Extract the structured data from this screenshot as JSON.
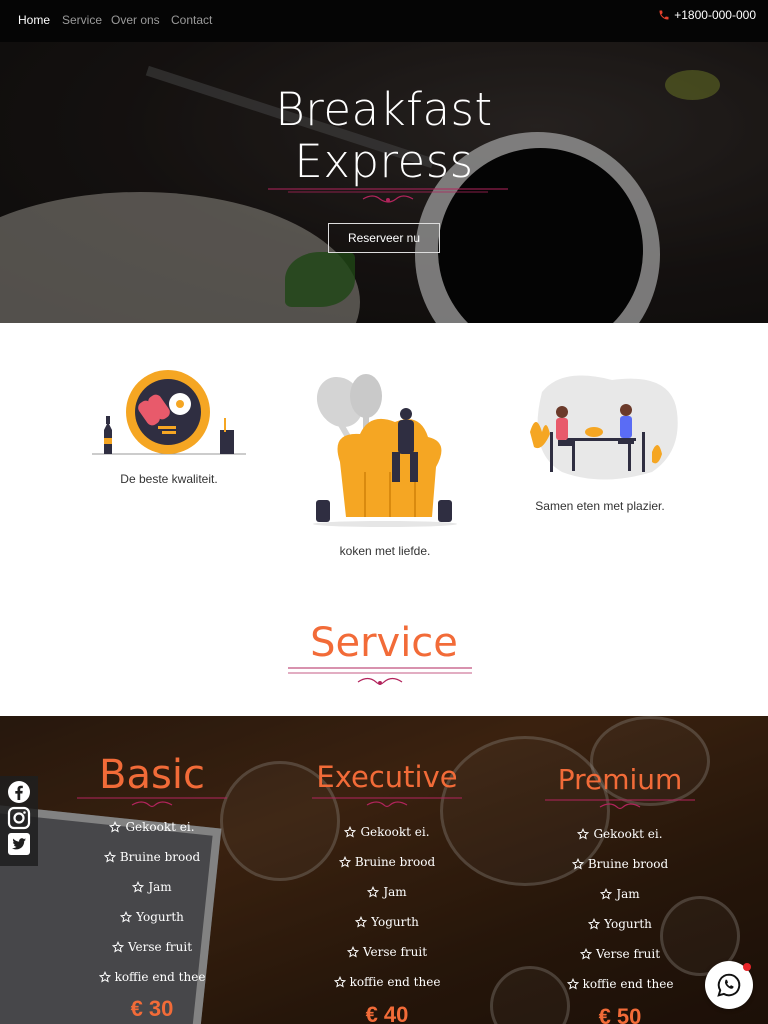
{
  "nav": {
    "links": [
      "Home",
      "Service",
      "Over ons",
      "Contact"
    ],
    "phone": "+1800-000-000"
  },
  "hero": {
    "title_line1": "Breakfast",
    "title_line2": "Express",
    "cta": "Reserveer nu"
  },
  "features": [
    {
      "label": "De beste kwaliteit."
    },
    {
      "label": "koken met liefde."
    },
    {
      "label": "Samen eten met plazier."
    }
  ],
  "service_title": "Service",
  "plans": [
    {
      "name": "Basic",
      "items": [
        "Gekookt ei.",
        "Bruine brood",
        "Jam",
        "Yogurth",
        "Verse fruit",
        "koffie end thee"
      ],
      "price": "€ 30"
    },
    {
      "name": "Executive",
      "items": [
        "Gekookt ei.",
        "Bruine brood",
        "Jam",
        "Yogurth",
        "Verse fruit",
        "koffie end thee"
      ],
      "price": "€ 40"
    },
    {
      "name": "Premium",
      "items": [
        "Gekookt ei.",
        "Bruine brood",
        "Jam",
        "Yogurth",
        "Verse fruit",
        "koffie end thee"
      ],
      "price": "€ 50"
    }
  ],
  "icons": [
    "phone-icon",
    "facebook-icon",
    "instagram-icon",
    "twitter-icon",
    "whatsapp-icon",
    "star-icon"
  ],
  "colors": {
    "accent": "#f26b38",
    "nav_bg": "#050505",
    "divider": "#b2245c"
  }
}
